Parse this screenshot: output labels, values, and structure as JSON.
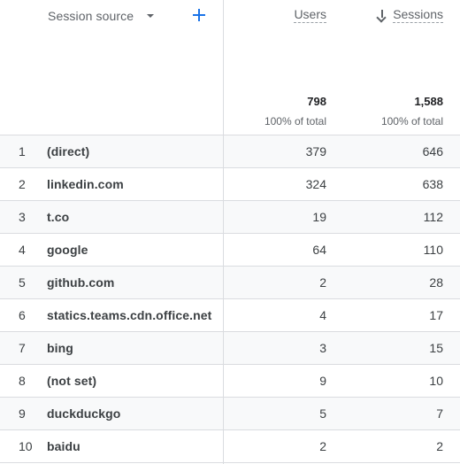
{
  "header": {
    "dimension_label": "Session source",
    "columns": {
      "users": {
        "label": "Users",
        "total": "798",
        "total_pct": "100% of total"
      },
      "sessions": {
        "label": "Sessions",
        "total": "1,588",
        "total_pct": "100% of total"
      }
    }
  },
  "rows": [
    {
      "index": "1",
      "source": "(direct)",
      "users": "379",
      "sessions": "646"
    },
    {
      "index": "2",
      "source": "linkedin.com",
      "users": "324",
      "sessions": "638"
    },
    {
      "index": "3",
      "source": "t.co",
      "users": "19",
      "sessions": "112"
    },
    {
      "index": "4",
      "source": "google",
      "users": "64",
      "sessions": "110"
    },
    {
      "index": "5",
      "source": "github.com",
      "users": "2",
      "sessions": "28"
    },
    {
      "index": "6",
      "source": "statics.teams.cdn.office.net",
      "users": "4",
      "sessions": "17"
    },
    {
      "index": "7",
      "source": "bing",
      "users": "3",
      "sessions": "15"
    },
    {
      "index": "8",
      "source": "(not set)",
      "users": "9",
      "sessions": "10"
    },
    {
      "index": "9",
      "source": "duckduckgo",
      "users": "5",
      "sessions": "7"
    },
    {
      "index": "10",
      "source": "baidu",
      "users": "2",
      "sessions": "2"
    }
  ],
  "icons": {
    "dimension_dropdown": "caret-down-icon",
    "add_dimension": "plus-icon",
    "sort_indicator": "arrow-down-icon"
  },
  "colors": {
    "accent": "#1a73e8",
    "divider": "#dadce0",
    "row_shade": "#f8f9fa",
    "muted_text": "#5f6368"
  }
}
